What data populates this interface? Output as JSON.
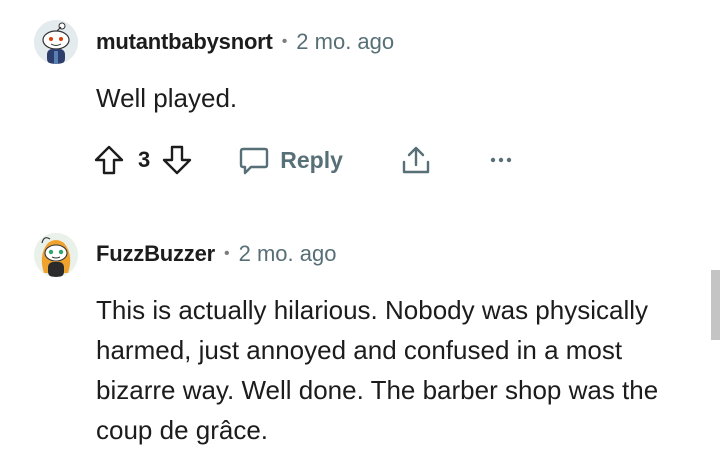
{
  "comments": [
    {
      "username": "mutantbabysnort",
      "separator": "•",
      "time": "2 mo. ago",
      "body": "Well played.",
      "actions": {
        "vote_count": "3",
        "reply_label": "Reply",
        "upvote_icon": "arrow-up-outline-icon",
        "downvote_icon": "arrow-down-outline-icon",
        "reply_icon": "speech-bubble-icon",
        "share_icon": "share-upload-icon",
        "more_icon": "ellipsis-icon"
      }
    },
    {
      "username": "FuzzBuzzer",
      "separator": "•",
      "time": "2 mo. ago",
      "body": "This is actually hilarious. Nobody was physically harmed, just annoyed and confused in a most bizarre way. Well done. The barber shop was the coup de grâce."
    }
  ],
  "colors": {
    "text": "#1c1c1c",
    "meta": "#576f76",
    "action_gray": "#576f76",
    "scrollbar": "#c4c4c4"
  }
}
